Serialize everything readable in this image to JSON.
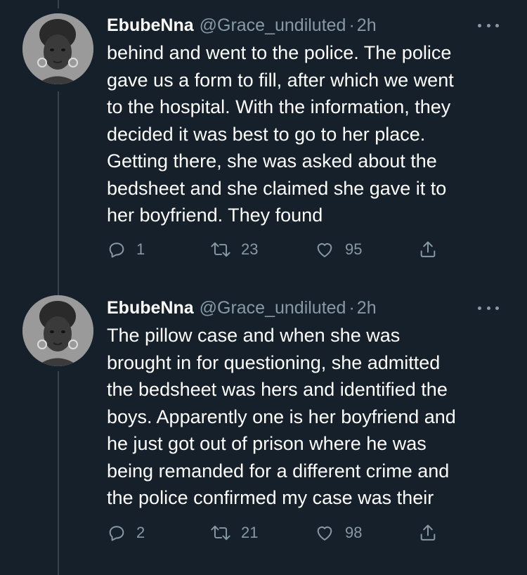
{
  "tweets": [
    {
      "author_name": "EbubeNna",
      "handle": "@Grace_undiluted",
      "separator": "·",
      "time": "2h",
      "text": "behind and went to the police. The police\ngave us a form to fill, after which we went\nto the hospital. With the information, they\ndecided it was best to go to her place.\nGetting there, she was asked about the\nbedsheet and she claimed she gave it to\nher boyfriend. They found",
      "replies": "1",
      "retweets": "23",
      "likes": "95"
    },
    {
      "author_name": "EbubeNna",
      "handle": "@Grace_undiluted",
      "separator": "·",
      "time": "2h",
      "text": "The pillow case and when she was\nbrought in for questioning, she admitted\nthe bedsheet was hers and identified the\nboys. Apparently one is her boyfriend and\nhe just got out of prison where he was\nbeing remanded for a different crime and\nthe police confirmed my case was their",
      "replies": "2",
      "retweets": "21",
      "likes": "98"
    }
  ],
  "icons": {
    "reply": "reply-icon",
    "retweet": "retweet-icon",
    "like": "heart-icon",
    "share": "share-icon",
    "more": "more-dots-icon"
  },
  "colors": {
    "background": "#15202b",
    "text": "#ffffff",
    "secondary": "#8899a6",
    "thread_line": "#38444d"
  }
}
